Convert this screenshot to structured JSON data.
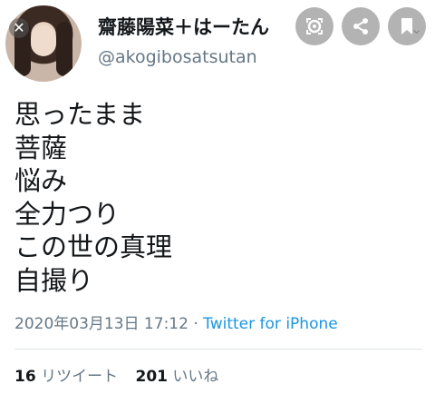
{
  "user": {
    "display_name": "齋藤陽菜＋はーたん",
    "handle": "@akogibosatsutan"
  },
  "tweet": {
    "lines": [
      "思ったまま",
      "菩薩",
      "悩み",
      "全力つり",
      "この世の真理",
      "自撮り"
    ]
  },
  "meta": {
    "timestamp": "2020年03月13日 17:12",
    "separator": " · ",
    "source": "Twitter for iPhone"
  },
  "stats": {
    "retweets": "16",
    "retweets_label": "リツイート",
    "likes": "201",
    "likes_label": "いいね"
  },
  "icons": {
    "close": "close-icon",
    "lens": "lens-icon",
    "share": "share-icon",
    "save": "bookmark-icon",
    "more": "chevron-down-icon"
  },
  "colors": {
    "text": "#14171a",
    "muted": "#657786",
    "link": "#1b95e0",
    "overlay_button": "#b3b3b3"
  }
}
